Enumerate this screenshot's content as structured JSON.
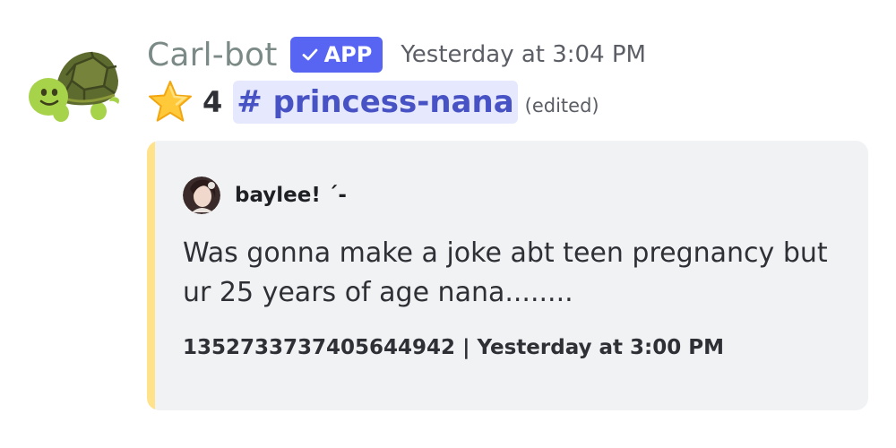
{
  "message": {
    "author": "Carl-bot",
    "badge": "APP",
    "timestamp": "Yesterday at 3:04 PM",
    "star_icon": "star-emoji",
    "star_count": "4",
    "channel": "# princess-nana",
    "edited": "(edited)"
  },
  "embed": {
    "accent_color": "#ffe28a",
    "author_name": "baylee! ˊ-",
    "description": "Was gonna make a joke abt teen pregnancy but ur 25 years of age nana........",
    "footer": "1352733737405644942 | Yesterday at 3:00 PM"
  },
  "colors": {
    "badge": "#5865f2",
    "mention_bg": "#e6e8fd",
    "mention_text": "#4752c4",
    "embed_bg": "#f1f2f4"
  }
}
